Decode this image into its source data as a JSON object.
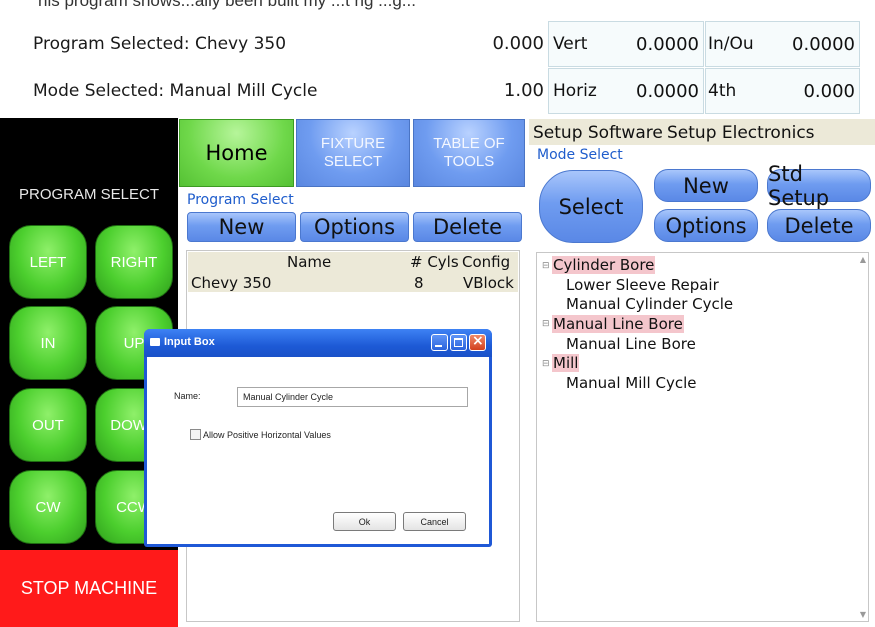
{
  "top_caption": "his program shows...ally been built my ...t ng ...g...",
  "status": {
    "program_label": "Program Selected: Chevy 350",
    "program_value": "0.000",
    "mode_label": "Mode Selected: Manual Mill Cycle",
    "mode_value": "1.00"
  },
  "coords": {
    "vert_label": "Vert",
    "vert_value": "0.0000",
    "inout_label": "In/Ou",
    "inout_value": "0.0000",
    "horiz_label": "Horiz",
    "horiz_value": "0.0000",
    "fourth_label": "4th",
    "fourth_value": "0.000"
  },
  "left_panel": {
    "title": "PROGRAM SELECT",
    "buttons": [
      "LEFT",
      "RIGHT",
      "IN",
      "UP",
      "OUT",
      "DOWN",
      "CW",
      "CCW"
    ],
    "stop": "STOP MACHINE"
  },
  "tabs": {
    "home": "Home",
    "fixture": "FIXTURE SELECT",
    "tools": "TABLE OF TOOLS"
  },
  "program_select": {
    "label": "Program Select",
    "new": "New",
    "options": "Options",
    "delete": "Delete",
    "columns": [
      "Name",
      "# Cyls",
      "Config"
    ],
    "rows": [
      {
        "name": "Chevy 350",
        "cyls": "8",
        "config": "VBlock"
      }
    ]
  },
  "setup_menu": {
    "software": "Setup Software",
    "electronics": "Setup Electronics"
  },
  "mode_select": {
    "label": "Mode Select",
    "select": "Select",
    "new": "New",
    "std_setup": "Std Setup",
    "options": "Options",
    "delete": "Delete",
    "tree": [
      {
        "category": "Cylinder Bore",
        "items": [
          "Lower Sleeve Repair",
          "Manual Cylinder Cycle"
        ]
      },
      {
        "category": "Manual Line Bore",
        "items": [
          "Manual Line Bore"
        ]
      },
      {
        "category": "Mill",
        "items": [
          "Manual Mill Cycle"
        ]
      }
    ]
  },
  "dialog": {
    "title": "Input Box",
    "name_label": "Name:",
    "name_value": "Manual Cylinder Cycle",
    "checkbox_label": "Allow Positive Horizontal Values",
    "ok": "Ok",
    "cancel": "Cancel"
  },
  "colors": {
    "accent_green": "#4ccf2e",
    "accent_blue": "#6f9cf0",
    "stop_red": "#ff1a1a",
    "category_highlight": "#f4c6cc"
  }
}
